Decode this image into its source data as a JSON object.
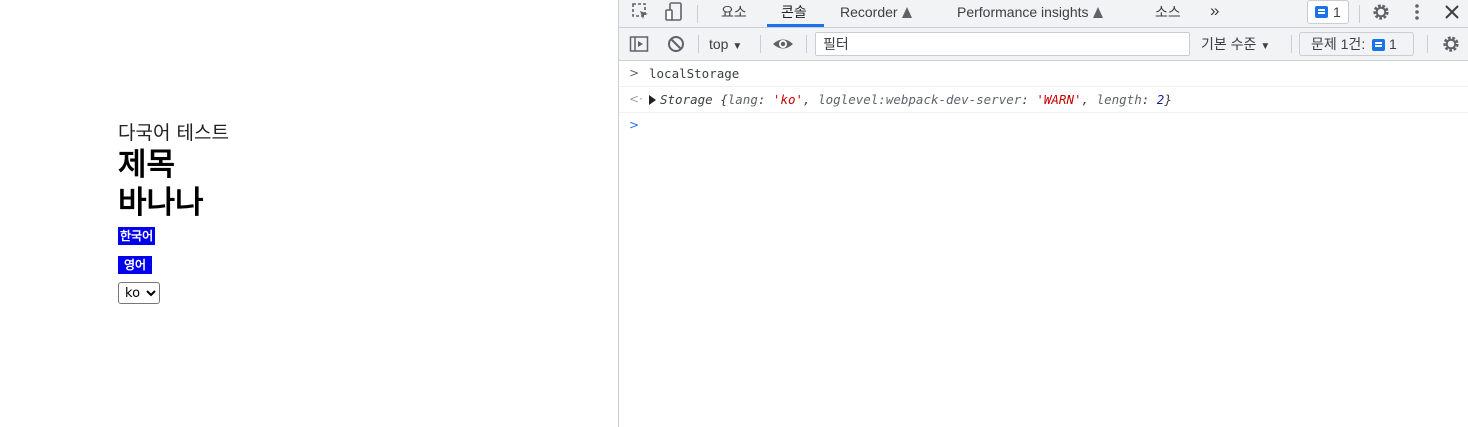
{
  "page": {
    "subtitle": "다국어 테스트",
    "title": "제목",
    "heading2": "바나나",
    "btn_korean": "한국어",
    "btn_english": "영어",
    "language_select": {
      "selected": "ko",
      "options": [
        "ko"
      ]
    }
  },
  "devtools": {
    "tabs": [
      "요소",
      "콘솔",
      "Recorder",
      "Performance insights",
      "소스"
    ],
    "active_tab": "콘솔",
    "more_tabs": "»",
    "issues_badge_count": "1",
    "toolbar": {
      "context": "top",
      "filter_placeholder": "필터",
      "levels": "기본 수준",
      "issues_label": "문제 1건:",
      "issues_count": "1"
    },
    "console": {
      "input_command": "localStorage",
      "result_prefix": "Storage",
      "result_open": "{",
      "entries": [
        {
          "key": "lang",
          "value": "'ko'"
        },
        {
          "key": "loglevel:webpack-dev-server",
          "value": "'WARN'"
        }
      ],
      "length_key": "length",
      "length_value": "2",
      "result_close": "}"
    },
    "icons": {
      "inspect": "inspect-icon",
      "device": "device-toolbar-icon",
      "settings": "gear-icon",
      "menu": "kebab-menu-icon",
      "close": "close-icon",
      "sidebar": "sidebar-toggle-icon",
      "clear": "clear-console-icon",
      "eye": "live-expression-icon"
    },
    "colors": {
      "accent": "#1a73e8",
      "string": "#c80000",
      "number": "#1a1aa6"
    }
  }
}
